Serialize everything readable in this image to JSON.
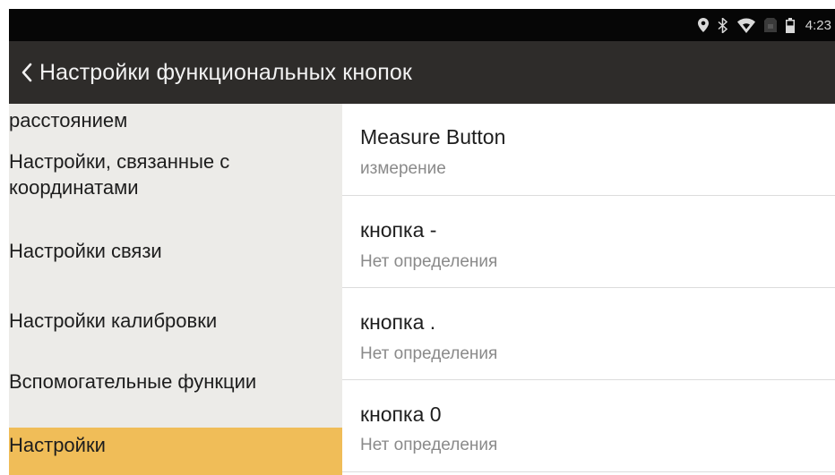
{
  "status_bar": {
    "time": "4:23",
    "icons": [
      "location-icon",
      "bluetooth-icon",
      "wifi-icon",
      "sim-icon",
      "battery-icon"
    ]
  },
  "toolbar": {
    "back_icon": "chevron-left-icon",
    "title": "Настройки функциональных кнопок"
  },
  "sidebar": {
    "items": [
      {
        "label": "расстоянием"
      },
      {
        "label": "Настройки, связанные с координатами"
      },
      {
        "label": "Настройки связи"
      },
      {
        "label": "Настройки калибровки"
      },
      {
        "label": "Вспомогательные функции"
      },
      {
        "label": "Настройки"
      }
    ],
    "selected_index": 5
  },
  "buttons_list": [
    {
      "title": "Measure Button",
      "subtitle": "измерение"
    },
    {
      "title": "кнопка -",
      "subtitle": "Нет определения"
    },
    {
      "title": "кнопка .",
      "subtitle": "Нет определения"
    },
    {
      "title": "кнопка 0",
      "subtitle": "Нет определения"
    }
  ],
  "colors": {
    "toolbar": "#2e2c2a",
    "status_bar": "#060606",
    "sidebar_bg": "#ecebe8",
    "selected": "#f0bd58"
  }
}
